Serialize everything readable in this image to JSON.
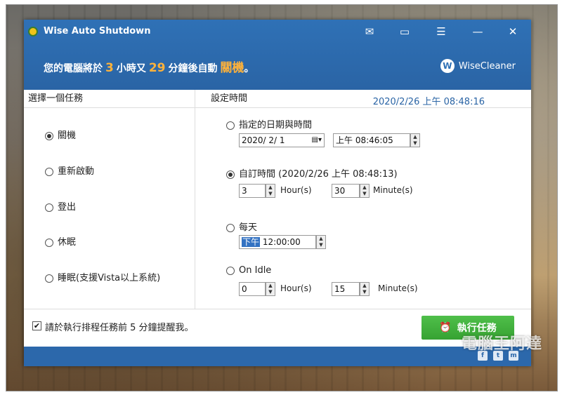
{
  "window": {
    "title": "Wise Auto Shutdown",
    "controls": [
      "mail-icon",
      "feedback-icon",
      "menu-icon",
      "minimize-icon",
      "close-icon"
    ]
  },
  "countdown": {
    "prefix": "您的電腦將於",
    "hours": "3",
    "mid": "小時又",
    "minutes": "29",
    "suffix": "分鐘後自動",
    "action": "關機",
    "end": "。"
  },
  "brand": {
    "logo": "W",
    "name": "WiseCleaner"
  },
  "tasks": {
    "header": "選擇一個任務",
    "items": [
      {
        "label": "關機",
        "selected": true
      },
      {
        "label": "重新啟動",
        "selected": false
      },
      {
        "label": "登出",
        "selected": false
      },
      {
        "label": "休眠",
        "selected": false
      },
      {
        "label": "睡眠(支援Vista以上系統)",
        "selected": false
      }
    ]
  },
  "schedule": {
    "header": "設定時間",
    "current_datetime": "2020/2/26 上午 08:48:16",
    "specific": {
      "label": "指定的日期與時間",
      "date": "2020/ 2/ 1",
      "time": "上午 08:46:05"
    },
    "custom": {
      "label": "自訂時間 (2020/2/26 上午 08:48:13)",
      "hours": "3",
      "hours_unit": "Hour(s)",
      "minutes": "30",
      "minutes_unit": "Minute(s)"
    },
    "daily": {
      "label": "每天",
      "ampm": "下午",
      "time": "12:00:00"
    },
    "idle": {
      "label": "On Idle",
      "hours": "0",
      "hours_unit": "Hour(s)",
      "minutes": "15",
      "minutes_unit": "Minute(s)"
    }
  },
  "footer": {
    "remind_checked": true,
    "remind_label": "請於執行排程任務前 5 分鐘提醒我。",
    "run_button": "執行任務"
  },
  "social": [
    "f",
    "t",
    "m"
  ],
  "watermark": "電腦王阿達",
  "colors": {
    "header": "#2f71b6",
    "accent": "#ffb23a",
    "run": "#3faf3b"
  }
}
